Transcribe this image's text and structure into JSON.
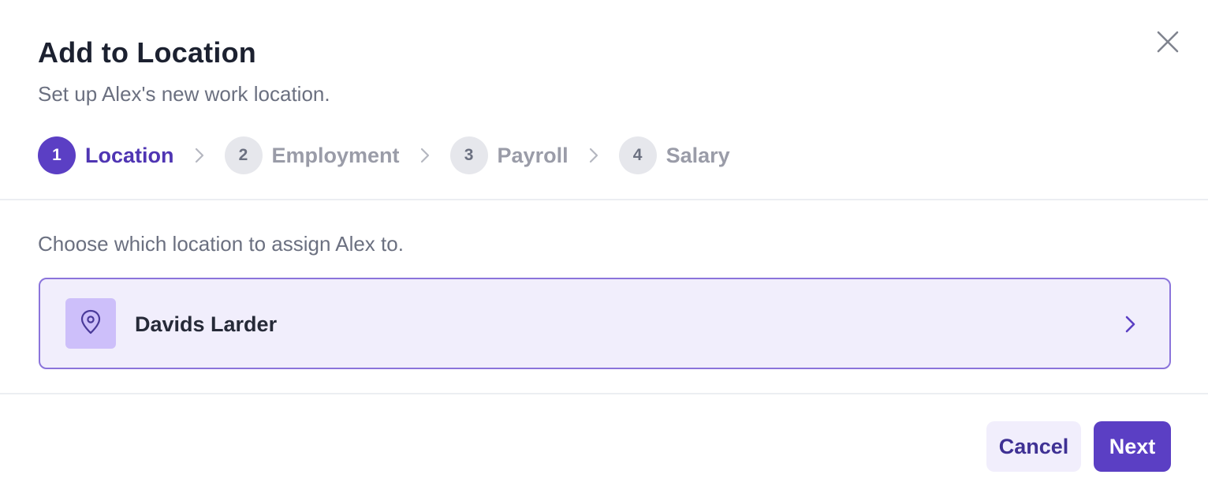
{
  "dialog": {
    "title": "Add to Location",
    "subtitle": "Set up Alex's new work location.",
    "close_icon": "close-icon"
  },
  "stepper": {
    "steps": [
      {
        "number": "1",
        "label": "Location",
        "active": true
      },
      {
        "number": "2",
        "label": "Employment",
        "active": false
      },
      {
        "number": "3",
        "label": "Payroll",
        "active": false
      },
      {
        "number": "4",
        "label": "Salary",
        "active": false
      }
    ],
    "separator_icon": "chevron-right-icon"
  },
  "body": {
    "prompt": "Choose which location to assign Alex to.",
    "locations": [
      {
        "name": "Davids Larder",
        "icon": "map-pin-icon",
        "selected": true
      }
    ]
  },
  "footer": {
    "cancel_label": "Cancel",
    "next_label": "Next"
  },
  "colors": {
    "accent": "#5b3fc4",
    "accent_text": "#4f35b3",
    "card_bg": "#f1eefc",
    "card_border": "#8b74db",
    "icon_box_bg": "#cdbffa",
    "muted_text": "#6b7080",
    "inactive_step_bg": "#e6e7ec"
  }
}
